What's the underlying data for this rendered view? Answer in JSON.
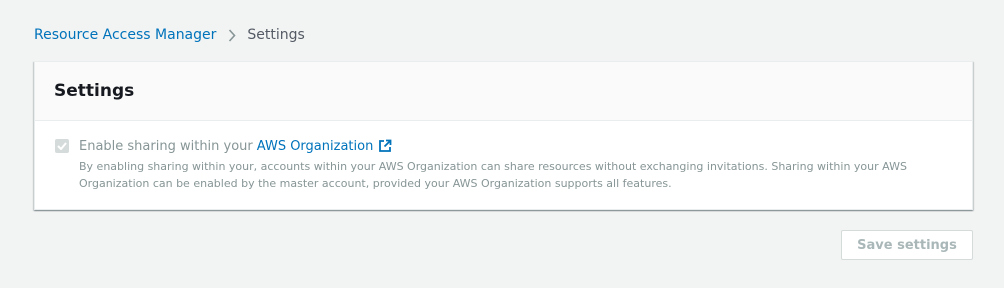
{
  "breadcrumb": {
    "items": [
      {
        "label": "Resource Access Manager"
      },
      {
        "label": "Settings"
      }
    ]
  },
  "panel": {
    "title": "Settings",
    "option": {
      "checked": true,
      "disabled": true,
      "label_prefix": "Enable sharing within your",
      "link_text": "AWS Organization",
      "icon": "external-link-icon",
      "description": "By enabling sharing within your, accounts within your AWS Organization can share resources without exchanging invitations. Sharing within your AWS Organization can be enabled by the master account, provided your AWS Organization supports all features."
    }
  },
  "actions": {
    "save_label": "Save settings"
  },
  "colors": {
    "link": "#0073bb",
    "background": "#f2f3f3",
    "disabled_text": "#879596"
  }
}
